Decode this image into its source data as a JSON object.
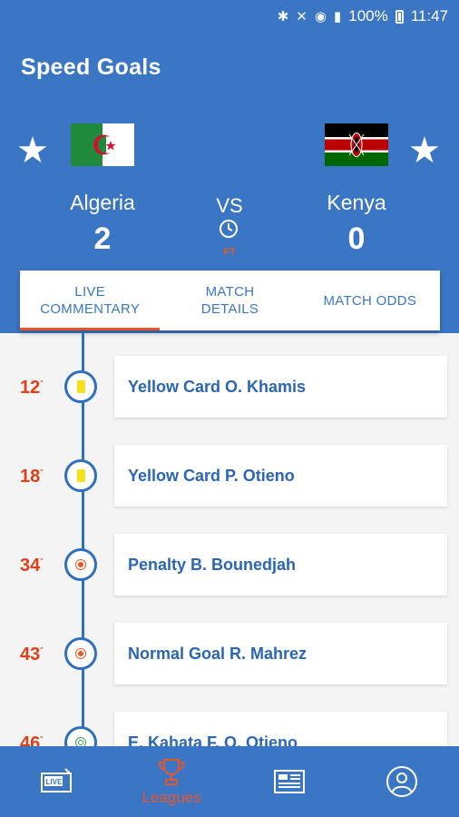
{
  "status_bar": {
    "battery_pct": "100%",
    "time": "11:47"
  },
  "app": {
    "title": "Speed Goals"
  },
  "match": {
    "home": {
      "name": "Algeria",
      "score": "2"
    },
    "away": {
      "name": "Kenya",
      "score": "0"
    },
    "vs_label": "VS",
    "status": "FT"
  },
  "tabs": [
    {
      "line1": "LIVE",
      "line2": "COMMENTARY",
      "active": true
    },
    {
      "line1": "MATCH",
      "line2": "DETAILS",
      "active": false
    },
    {
      "line1": "MATCH ODDS",
      "line2": "",
      "active": false
    }
  ],
  "events": [
    {
      "minute": "12",
      "mark": "\"",
      "type": "yellow-card",
      "text": "Yellow Card O. Khamis"
    },
    {
      "minute": "18",
      "mark": "\"",
      "type": "yellow-card",
      "text": "Yellow Card P. Otieno"
    },
    {
      "minute": "34",
      "mark": "\"",
      "type": "penalty",
      "text": "Penalty B. Bounedjah"
    },
    {
      "minute": "43",
      "mark": "\"",
      "type": "goal",
      "text": "Normal Goal R. Mahrez"
    },
    {
      "minute": "46",
      "mark": "\"",
      "type": "substitution",
      "text": "E. Kahata F. O. Otieno"
    }
  ],
  "bottom_nav": {
    "active_label": "Leagues",
    "live_icon_text": "LIVE"
  },
  "colors": {
    "primary": "#3a76c4",
    "accent": "#e8552b",
    "minute_red": "#e03e17"
  }
}
